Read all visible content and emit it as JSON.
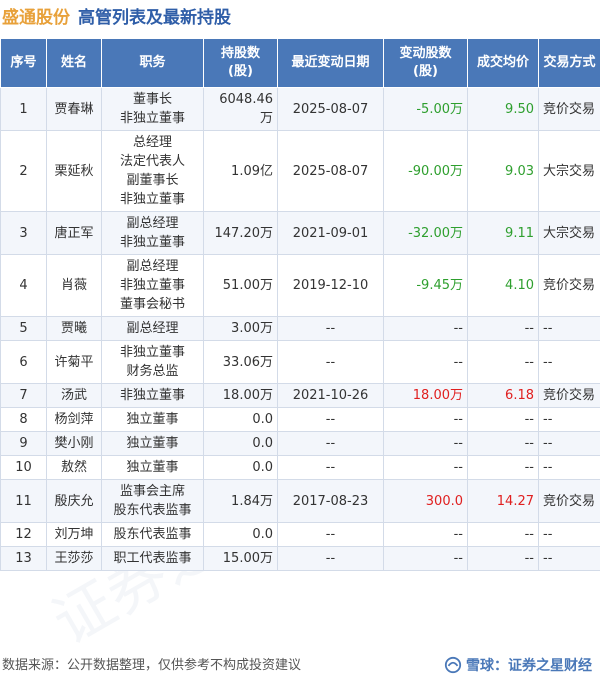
{
  "header": {
    "company": "盛通股份",
    "subtitle": "高管列表及最新持股"
  },
  "columns": [
    "序号",
    "姓名",
    "职务",
    "持股数\n(股)",
    "最近变动日期",
    "变动股数\n(股)",
    "成交均价",
    "交易方式"
  ],
  "rows": [
    {
      "no": "1",
      "name": "贾春琳",
      "positions": [
        "董事长",
        "非独立董事"
      ],
      "shares": "6048.46万",
      "date": "2025-08-07",
      "change": "-5.00万",
      "change_type": "neg",
      "price": "9.50",
      "price_type": "neg",
      "mode": "竞价交易"
    },
    {
      "no": "2",
      "name": "栗延秋",
      "positions": [
        "总经理",
        "法定代表人",
        "副董事长",
        "非独立董事"
      ],
      "shares": "1.09亿",
      "date": "2025-08-07",
      "change": "-90.00万",
      "change_type": "neg",
      "price": "9.03",
      "price_type": "neg",
      "mode": "大宗交易"
    },
    {
      "no": "3",
      "name": "唐正军",
      "positions": [
        "副总经理",
        "非独立董事"
      ],
      "shares": "147.20万",
      "date": "2021-09-01",
      "change": "-32.00万",
      "change_type": "neg",
      "price": "9.11",
      "price_type": "neg",
      "mode": "大宗交易"
    },
    {
      "no": "4",
      "name": "肖薇",
      "positions": [
        "副总经理",
        "非独立董事",
        "董事会秘书"
      ],
      "shares": "51.00万",
      "date": "2019-12-10",
      "change": "-9.45万",
      "change_type": "neg",
      "price": "4.10",
      "price_type": "neg",
      "mode": "竞价交易"
    },
    {
      "no": "5",
      "name": "贾曦",
      "positions": [
        "副总经理"
      ],
      "shares": "3.00万",
      "date": "--",
      "change": "--",
      "change_type": "dash",
      "price": "--",
      "price_type": "dash",
      "mode": "--"
    },
    {
      "no": "6",
      "name": "许菊平",
      "positions": [
        "非独立董事",
        "财务总监"
      ],
      "shares": "33.06万",
      "date": "--",
      "change": "--",
      "change_type": "dash",
      "price": "--",
      "price_type": "dash",
      "mode": "--"
    },
    {
      "no": "7",
      "name": "汤武",
      "positions": [
        "非独立董事"
      ],
      "shares": "18.00万",
      "date": "2021-10-26",
      "change": "18.00万",
      "change_type": "pos",
      "price": "6.18",
      "price_type": "pos",
      "mode": "竞价交易"
    },
    {
      "no": "8",
      "name": "杨剑萍",
      "positions": [
        "独立董事"
      ],
      "shares": "0.0",
      "date": "--",
      "change": "--",
      "change_type": "dash",
      "price": "--",
      "price_type": "dash",
      "mode": "--"
    },
    {
      "no": "9",
      "name": "樊小刚",
      "positions": [
        "独立董事"
      ],
      "shares": "0.0",
      "date": "--",
      "change": "--",
      "change_type": "dash",
      "price": "--",
      "price_type": "dash",
      "mode": "--"
    },
    {
      "no": "10",
      "name": "敖然",
      "positions": [
        "独立董事"
      ],
      "shares": "0.0",
      "date": "--",
      "change": "--",
      "change_type": "dash",
      "price": "--",
      "price_type": "dash",
      "mode": "--"
    },
    {
      "no": "11",
      "name": "殷庆允",
      "positions": [
        "监事会主席",
        "股东代表监事"
      ],
      "shares": "1.84万",
      "date": "2017-08-23",
      "change": "300.0",
      "change_type": "pos",
      "price": "14.27",
      "price_type": "pos",
      "mode": "竞价交易"
    },
    {
      "no": "12",
      "name": "刘万坤",
      "positions": [
        "股东代表监事"
      ],
      "shares": "0.0",
      "date": "--",
      "change": "--",
      "change_type": "dash",
      "price": "--",
      "price_type": "dash",
      "mode": "--"
    },
    {
      "no": "13",
      "name": "王莎莎",
      "positions": [
        "职工代表监事"
      ],
      "shares": "15.00万",
      "date": "--",
      "change": "--",
      "change_type": "dash",
      "price": "--",
      "price_type": "dash",
      "mode": "--"
    }
  ],
  "footer": {
    "source": "数据来源：公开数据整理，仅供参考不构成投资建议",
    "brand": "雪球：证券之星财经"
  },
  "watermark": "证券之星",
  "colors": {
    "header_bg": "#4a78b8",
    "company": "#e8a13a",
    "subtitle": "#2f5ea8",
    "negative": "#2e9f2e",
    "positive": "#e02020"
  }
}
